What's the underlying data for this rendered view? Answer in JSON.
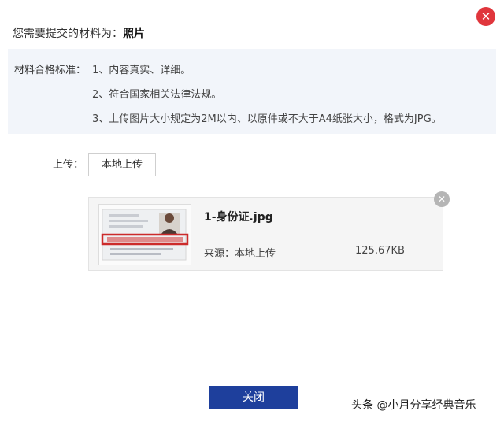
{
  "dialog": {
    "close_icon": "close-icon",
    "required_label": "您需要提交的材料为：",
    "required_value": "照片",
    "criteria": {
      "label": "材料合格标准：",
      "items": [
        "1、内容真实、详细。",
        "2、符合国家相关法律法规。",
        "3、上传图片大小规定为2M以内、以原件或不大于A4纸张大小，格式为JPG。"
      ]
    },
    "upload": {
      "label": "上传：",
      "button_label": "本地上传"
    },
    "file": {
      "name": "1-身份证.jpg",
      "source": "来源：本地上传",
      "size": "125.67KB"
    },
    "close_button_label": "关闭"
  },
  "watermark": "头条 @小月分享经典音乐",
  "colors": {
    "accent": "#1e3f9c",
    "close_red": "#e0363c",
    "panel_bg": "#f2f5fa"
  }
}
